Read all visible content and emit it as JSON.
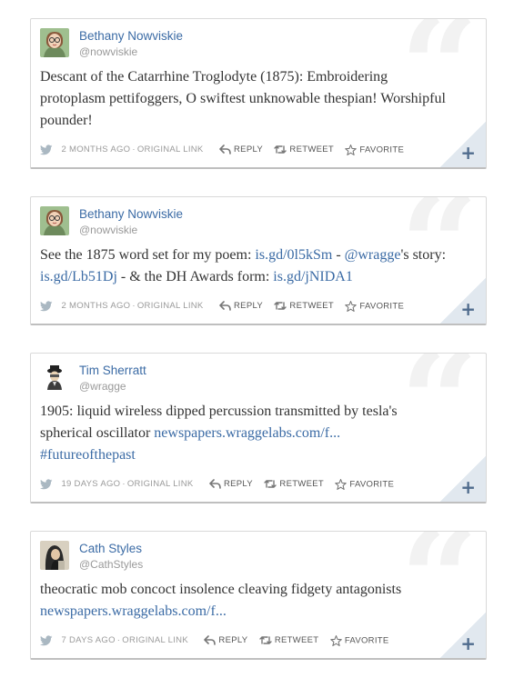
{
  "icons": {
    "bird": "twitter-bird-icon",
    "reply": "reply-arrow-icon",
    "retweet": "retweet-icon",
    "favorite": "star-icon",
    "expand": "plus-icon"
  },
  "colors": {
    "link": "#3b6ba5",
    "meta": "#9a9a9a",
    "corner": "#e1e8ef"
  },
  "tweets": [
    {
      "name": "Bethany Nowviskie",
      "handle": "@nowviskie",
      "text": "Descant of the Catarrhine Troglodyte (1875): Embroidering protoplasm pettifoggers, O swiftest unknowable thespian! Worshipful pounder!",
      "time": "2 MONTHS AGO",
      "sep": "·",
      "original": "ORIGINAL LINK",
      "reply": "REPLY",
      "retweet": "RETWEET",
      "favorite": "FAVORITE",
      "expand": "+"
    },
    {
      "name": "Bethany Nowviskie",
      "handle": "@nowviskie",
      "text_parts": {
        "p1": "See the 1875 word set for my poem: ",
        "l1": "is.gd/0l5kSm",
        "p2": " - ",
        "l2": "@wragge",
        "p3": "'s story: ",
        "l3": "is.gd/Lb51Dj",
        "p4": " - & the DH Awards form: ",
        "l4": "is.gd/jNIDA1"
      },
      "time": "2 MONTHS AGO",
      "sep": "·",
      "original": "ORIGINAL LINK",
      "reply": "REPLY",
      "retweet": "RETWEET",
      "favorite": "FAVORITE",
      "expand": "+"
    },
    {
      "name": "Tim Sherratt",
      "handle": "@wragge",
      "text_parts": {
        "p1": "1905: liquid wireless dipped percussion transmitted by tesla's spherical oscillator ",
        "l1": "newspapers.wraggelabs.com/f...",
        "p2": " ",
        "l2": "#futureofthepast"
      },
      "time": "19 DAYS AGO",
      "sep": "·",
      "original": "ORIGINAL LINK",
      "reply": "REPLY",
      "retweet": "RETWEET",
      "favorite": "FAVORITE",
      "expand": "+"
    },
    {
      "name": "Cath Styles",
      "handle": "@CathStyles",
      "text_parts": {
        "p1": "theocratic mob concoct insolence cleaving fidgety antagonists ",
        "l1": "newspapers.wraggelabs.com/f..."
      },
      "time": "7 DAYS AGO",
      "sep": "·",
      "original": "ORIGINAL LINK",
      "reply": "REPLY",
      "retweet": "RETWEET",
      "favorite": "FAVORITE",
      "expand": "+"
    }
  ]
}
